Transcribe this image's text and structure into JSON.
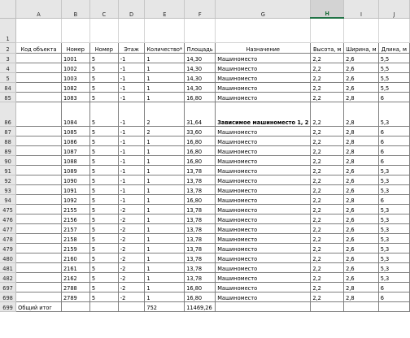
{
  "columns": [
    "A",
    "B",
    "C",
    "D",
    "E",
    "F",
    "G",
    "H",
    "I",
    "J"
  ],
  "selected_column": "H",
  "rows": [
    {
      "n": "1",
      "type": "blank",
      "cells": [
        "",
        "",
        "",
        "",
        "",
        "",
        "",
        "",
        "",
        ""
      ]
    },
    {
      "n": "2",
      "type": "header",
      "cells": [
        "Код объекта",
        "Номер",
        "Номер",
        "Этаж",
        "Количество*",
        "Площадь",
        "Назначение",
        "Высота, м",
        "Ширина, м",
        "Длина, м"
      ]
    },
    {
      "n": "3",
      "type": "data",
      "cells": [
        "",
        "1001",
        "5",
        "-1",
        "1",
        "14,30",
        "Машиноместо",
        "2,2",
        "2,6",
        "5,5"
      ]
    },
    {
      "n": "4",
      "type": "data",
      "cells": [
        "",
        "1002",
        "5",
        "-1",
        "1",
        "14,30",
        "Машиноместо",
        "2,2",
        "2,6",
        "5,5"
      ]
    },
    {
      "n": "5",
      "type": "data",
      "cells": [
        "",
        "1003",
        "5",
        "-1",
        "1",
        "14,30",
        "Машиноместо",
        "2,2",
        "2,6",
        "5,5"
      ]
    },
    {
      "n": "84",
      "type": "data",
      "cells": [
        "",
        "1082",
        "5",
        "-1",
        "1",
        "14,30",
        "Машиноместо",
        "2,2",
        "2,6",
        "5,5"
      ]
    },
    {
      "n": "85",
      "type": "data",
      "cells": [
        "",
        "1083",
        "5",
        "-1",
        "1",
        "16,80",
        "Машиноместо",
        "2,2",
        "2,8",
        "6"
      ]
    },
    {
      "n": "86",
      "type": "tall",
      "cells": [
        "",
        "1084",
        "5",
        "-1",
        "2",
        "31,64",
        "Зависимое машиноместо 1, 2",
        "2,2",
        "2,8",
        "5,3"
      ]
    },
    {
      "n": "87",
      "type": "data",
      "cells": [
        "",
        "1085",
        "5",
        "-1",
        "2",
        "33,60",
        "Машиноместо",
        "2,2",
        "2,8",
        "6"
      ]
    },
    {
      "n": "88",
      "type": "data",
      "cells": [
        "",
        "1086",
        "5",
        "-1",
        "1",
        "16,80",
        "Машиноместо",
        "2,2",
        "2,8",
        "6"
      ]
    },
    {
      "n": "89",
      "type": "data",
      "cells": [
        "",
        "1087",
        "5",
        "-1",
        "1",
        "16,80",
        "Машиноместо",
        "2,2",
        "2,8",
        "6"
      ]
    },
    {
      "n": "90",
      "type": "data",
      "cells": [
        "",
        "1088",
        "5",
        "-1",
        "1",
        "16,80",
        "Машиноместо",
        "2,2",
        "2,8",
        "6"
      ]
    },
    {
      "n": "91",
      "type": "data",
      "cells": [
        "",
        "1089",
        "5",
        "-1",
        "1",
        "13,78",
        "Машиноместо",
        "2,2",
        "2,6",
        "5,3"
      ]
    },
    {
      "n": "92",
      "type": "data",
      "cells": [
        "",
        "1090",
        "5",
        "-1",
        "1",
        "13,78",
        "Машиноместо",
        "2,2",
        "2,6",
        "5,3"
      ]
    },
    {
      "n": "93",
      "type": "data",
      "cells": [
        "",
        "1091",
        "5",
        "-1",
        "1",
        "13,78",
        "Машиноместо",
        "2,2",
        "2,6",
        "5,3"
      ]
    },
    {
      "n": "94",
      "type": "data",
      "cells": [
        "",
        "1092",
        "5",
        "-1",
        "1",
        "16,80",
        "Машиноместо",
        "2,2",
        "2,8",
        "6"
      ]
    },
    {
      "n": "475",
      "type": "data",
      "cells": [
        "",
        "2155",
        "5",
        "-2",
        "1",
        "13,78",
        "Машиноместо",
        "2,2",
        "2,6",
        "5,3"
      ]
    },
    {
      "n": "476",
      "type": "data",
      "cells": [
        "",
        "2156",
        "5",
        "-2",
        "1",
        "13,78",
        "Машиноместо",
        "2,2",
        "2,6",
        "5,3"
      ]
    },
    {
      "n": "477",
      "type": "data",
      "cells": [
        "",
        "2157",
        "5",
        "-2",
        "1",
        "13,78",
        "Машиноместо",
        "2,2",
        "2,6",
        "5,3"
      ]
    },
    {
      "n": "478",
      "type": "data",
      "cells": [
        "",
        "2158",
        "5",
        "-2",
        "1",
        "13,78",
        "Машиноместо",
        "2,2",
        "2,6",
        "5,3"
      ]
    },
    {
      "n": "479",
      "type": "data",
      "cells": [
        "",
        "2159",
        "5",
        "-2",
        "1",
        "13,78",
        "Машиноместо",
        "2,2",
        "2,6",
        "5,3"
      ]
    },
    {
      "n": "480",
      "type": "data",
      "cells": [
        "",
        "2160",
        "5",
        "-2",
        "1",
        "13,78",
        "Машиноместо",
        "2,2",
        "2,6",
        "5,3"
      ]
    },
    {
      "n": "481",
      "type": "data",
      "cells": [
        "",
        "2161",
        "5",
        "-2",
        "1",
        "13,78",
        "Машиноместо",
        "2,2",
        "2,6",
        "5,3"
      ]
    },
    {
      "n": "482",
      "type": "data",
      "cells": [
        "",
        "2162",
        "5",
        "-2",
        "1",
        "13,78",
        "Машиноместо",
        "2,2",
        "2,6",
        "5,3"
      ]
    },
    {
      "n": "697",
      "type": "data",
      "cells": [
        "",
        "2788",
        "5",
        "-2",
        "1",
        "16,80",
        "Машиноместо",
        "2,2",
        "2,8",
        "6"
      ]
    },
    {
      "n": "698",
      "type": "data",
      "cells": [
        "",
        "2789",
        "5",
        "-2",
        "1",
        "16,80",
        "Машиноместо",
        "2,2",
        "2,8",
        "6"
      ]
    },
    {
      "n": "699",
      "type": "total",
      "cells": [
        "Общий итог",
        "",
        "",
        "",
        "752",
        "11469,26",
        "",
        "",
        "",
        ""
      ]
    }
  ]
}
